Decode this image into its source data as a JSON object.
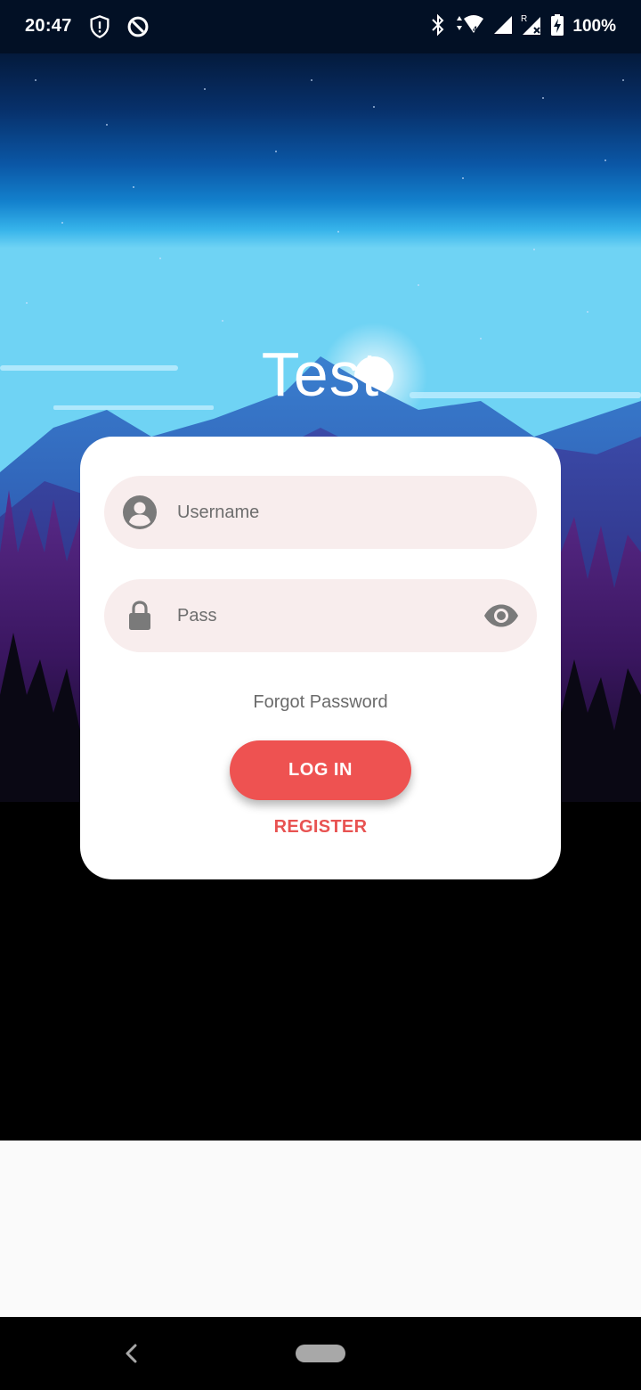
{
  "status_bar": {
    "time": "20:47",
    "left_icons": [
      "shield-alert-icon",
      "data-saver-icon"
    ],
    "right_icons": [
      "bluetooth-icon",
      "wifi-data-arrows-icon",
      "cell-signal-icon",
      "cell-signal-roaming-icon",
      "battery-charging-icon"
    ],
    "battery": "100%"
  },
  "app": {
    "title": "Test"
  },
  "login_form": {
    "username_placeholder": "Username",
    "password_placeholder": "Pass",
    "forgot_label": "Forgot Password",
    "login_label": "LOG IN",
    "register_label": "REGISTER"
  },
  "colors": {
    "accent": "#ee5251",
    "field_background": "#f8eded",
    "card_background": "#ffffff"
  },
  "nav_bar": {
    "buttons": [
      "back-icon",
      "home-pill"
    ]
  }
}
